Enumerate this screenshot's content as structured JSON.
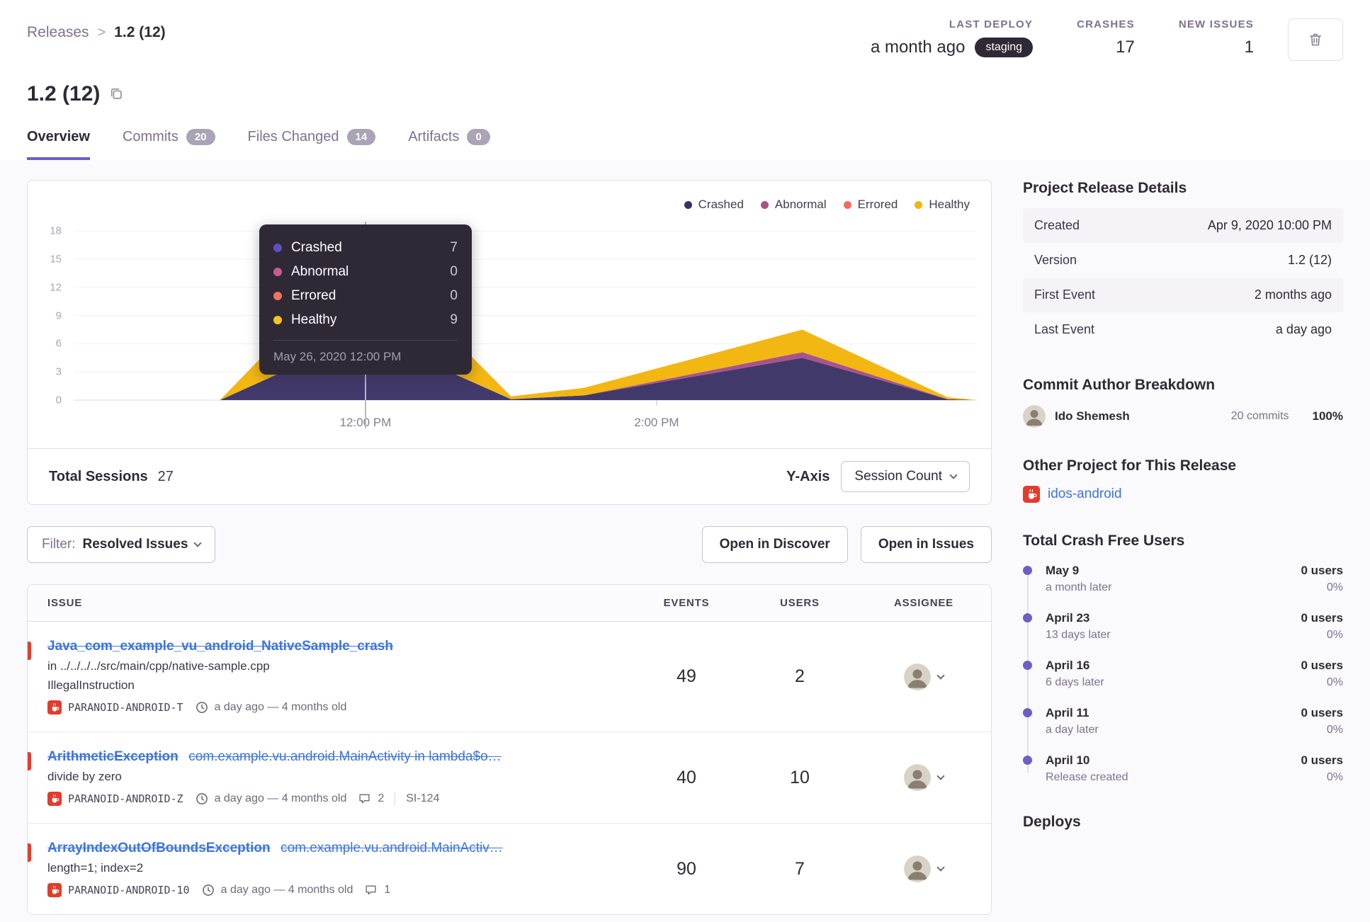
{
  "breadcrumb": {
    "parent": "Releases",
    "separator": ">",
    "current": "1.2 (12)"
  },
  "header_stats": {
    "last_deploy_label": "LAST DEPLOY",
    "last_deploy_value": "a month ago",
    "deploy_env_badge": "staging",
    "crashes_label": "CRASHES",
    "crashes_value": "17",
    "new_issues_label": "NEW ISSUES",
    "new_issues_value": "1"
  },
  "title": "1.2 (12)",
  "tabs": {
    "overview": "Overview",
    "commits": "Commits",
    "commits_count": "20",
    "files": "Files Changed",
    "files_count": "14",
    "artifacts": "Artifacts",
    "artifacts_count": "0"
  },
  "chart": {
    "legend": {
      "crashed": "Crashed",
      "abnormal": "Abnormal",
      "errored": "Errored",
      "healthy": "Healthy"
    },
    "tooltip": {
      "crashed_label": "Crashed",
      "crashed_value": "7",
      "abnormal_label": "Abnormal",
      "abnormal_value": "0",
      "errored_label": "Errored",
      "errored_value": "0",
      "healthy_label": "Healthy",
      "healthy_value": "9",
      "timestamp": "May 26, 2020 12:00 PM"
    },
    "footer": {
      "total_sessions_label": "Total Sessions",
      "total_sessions_value": "27",
      "y_axis_label": "Y-Axis",
      "y_axis_selected": "Session Count"
    }
  },
  "chart_data": {
    "type": "area",
    "stacked": true,
    "title": "Release sessions over time",
    "yaxis": "Session Count",
    "total_sessions": 27,
    "x_unit": "hour_of_day",
    "x_hours": [
      10,
      11,
      12,
      13,
      13.5,
      15,
      16,
      16.2
    ],
    "series": [
      {
        "name": "Crashed",
        "color": "#42396b",
        "values": [
          0,
          0,
          7,
          0.1,
          0.5,
          4.5,
          0.1,
          0
        ]
      },
      {
        "name": "Abnormal",
        "color": "#a9538c",
        "values": [
          0,
          0,
          0,
          0,
          0,
          0.6,
          0,
          0
        ]
      },
      {
        "name": "Errored",
        "color": "#ef6d5a",
        "values": [
          0,
          0,
          0,
          0,
          0,
          0,
          0,
          0
        ]
      },
      {
        "name": "Healthy",
        "color": "#f2b712",
        "values": [
          0,
          0,
          9,
          0.3,
          0.8,
          2.4,
          0.2,
          0
        ]
      }
    ],
    "xlim": [
      10,
      16.2
    ],
    "ylim": [
      0,
      19
    ],
    "y_tick_values": [
      0,
      3,
      6,
      9,
      12,
      15,
      18
    ],
    "x_tick_positions": [
      {
        "hour": 12,
        "label": "12:00 PM"
      },
      {
        "hour": 14,
        "label": "2:00 PM"
      }
    ],
    "tooltip_anchor_hour": 12,
    "grid": true,
    "legend_position": "top-right"
  },
  "issues_section": {
    "filter_label": "Filter:",
    "filter_value": "Resolved Issues",
    "open_in_discover": "Open in Discover",
    "open_in_issues": "Open in Issues",
    "columns": {
      "issue": "ISSUE",
      "events": "EVENTS",
      "users": "USERS",
      "assignee": "ASSIGNEE"
    },
    "rows": [
      {
        "title": "Java_com_example_vu_android_NativeSample_crash",
        "location": "in ../../../../src/main/cpp/native-sample.cpp",
        "value": "IllegalInstruction",
        "tag": "PARANOID-ANDROID-T",
        "age": "a day ago — 4 months old",
        "events": "49",
        "users": "2"
      },
      {
        "title": "ArithmeticException",
        "culprit": "com.example.vu.android.MainActivity in lambda$o…",
        "value": "divide by zero",
        "tag": "PARANOID-ANDROID-Z",
        "age": "a day ago — 4 months old",
        "comments": "2",
        "short_id": "SI-124",
        "events": "40",
        "users": "10"
      },
      {
        "title": "ArrayIndexOutOfBoundsException",
        "culprit": "com.example.vu.android.MainActiv…",
        "value": "length=1; index=2",
        "tag": "PARANOID-ANDROID-10",
        "age": "a day ago — 4 months old",
        "comments": "1",
        "events": "90",
        "users": "7"
      }
    ]
  },
  "sidebar": {
    "release_details": {
      "heading": "Project Release Details",
      "rows": [
        {
          "label": "Created",
          "value": "Apr 9, 2020 10:00 PM"
        },
        {
          "label": "Version",
          "value": "1.2 (12)"
        },
        {
          "label": "First Event",
          "value": "2 months ago"
        },
        {
          "label": "Last Event",
          "value": "a day ago"
        }
      ]
    },
    "commit_authors": {
      "heading": "Commit Author Breakdown",
      "author_name": "Ido Shemesh",
      "commits": "20 commits",
      "percent": "100%"
    },
    "other_projects": {
      "heading": "Other Project for This Release",
      "project_name": "idos-android"
    },
    "crash_free": {
      "heading": "Total Crash Free Users",
      "entries": [
        {
          "date": "May 9",
          "subtitle": "a month later",
          "users": "0 users",
          "percent": "0%"
        },
        {
          "date": "April 23",
          "subtitle": "13 days later",
          "users": "0 users",
          "percent": "0%"
        },
        {
          "date": "April 16",
          "subtitle": "6 days later",
          "users": "0 users",
          "percent": "0%"
        },
        {
          "date": "April 11",
          "subtitle": "a day later",
          "users": "0 users",
          "percent": "0%"
        },
        {
          "date": "April 10",
          "subtitle": "Release created",
          "users": "0 users",
          "percent": "0%"
        }
      ]
    },
    "deploys_heading": "Deploys"
  },
  "colors": {
    "accent_purple": "#6c5fc7",
    "link_blue": "#3d74db",
    "crashed": "#42396b",
    "abnormal": "#a9538c",
    "errored": "#ef6d5a",
    "healthy": "#f2b712",
    "resolved_indicator_red": "#e03e2f",
    "staging_badge_bg": "#2f2936"
  }
}
